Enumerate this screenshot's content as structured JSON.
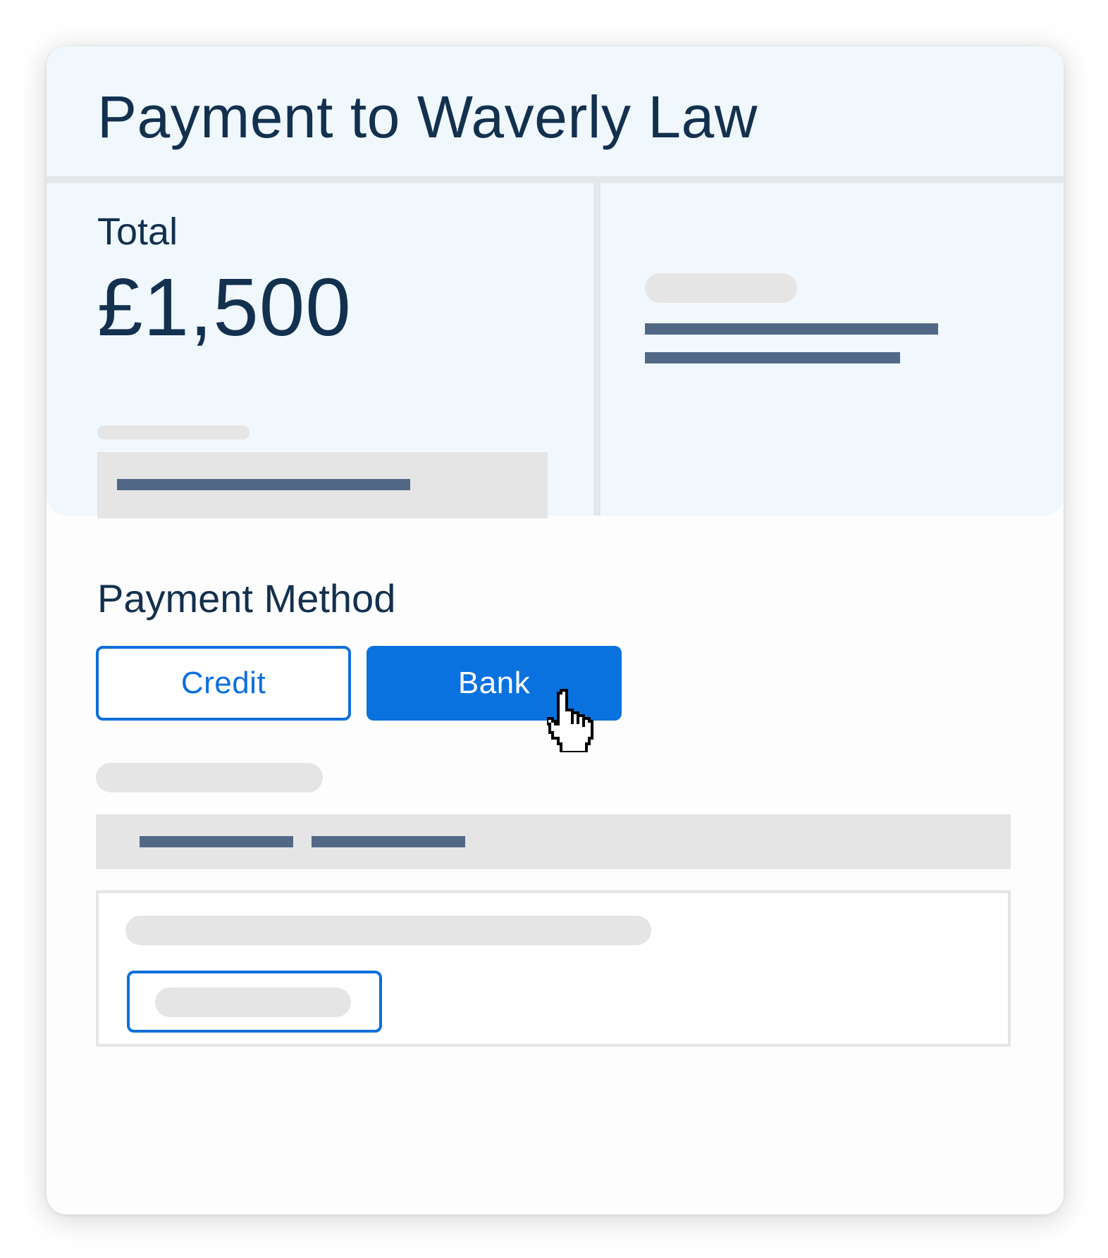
{
  "header": {
    "title": "Payment to Waverly Law"
  },
  "summary": {
    "total_label": "Total",
    "total_amount": "£1,500"
  },
  "payment_method": {
    "title": "Payment Method",
    "options": [
      {
        "label": "Credit",
        "selected": false
      },
      {
        "label": "Bank",
        "selected": true
      }
    ]
  },
  "colors": {
    "accent": "#0a72df",
    "title_text": "#13304f",
    "panel_bg": "#f0f8fe",
    "placeholder": "#e5e5e5",
    "placeholder_line": "#526887"
  },
  "icons": {
    "cursor": "hand-pointer-icon"
  }
}
